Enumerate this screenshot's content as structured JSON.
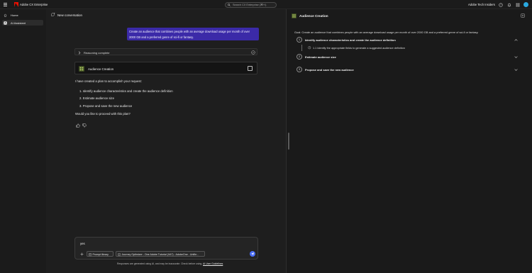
{
  "app": {
    "title": "Adobe CX Enterprise",
    "org_name": "Adobe Tech Insiders",
    "search_placeholder": "Search CX Enterprise (⌘+/)"
  },
  "sidebar": {
    "items": [
      {
        "label": "Home",
        "icon": "home-icon"
      },
      {
        "label": "AI Assistant",
        "icon": "ai-assistant-icon",
        "active": true
      }
    ]
  },
  "conversation": {
    "title": "New conversation",
    "user_message_line1": "Create an audience that combines people with an average download usage per month of over",
    "user_message_line2": "2000 GB and a preferred genre of sci-fi or fantasy.",
    "reasoning_label": "Reasoning complete",
    "card_title": "Audience Creation",
    "response_intro": "I have created a plan to accomplish your request:",
    "plan_items": [
      "1. Identify audience characteristics and create the audience definition",
      "2. Estimate audience size",
      "3. Propose and save the new audience"
    ],
    "response_question": "Would you like to proceed with this plan?",
    "composer_value": "yes",
    "prompt_library_label": "Prompt library",
    "context_chip_label": "Journey Optimizer - One Adobe Tutorial (VA7) - AdobeOne - Unifie...",
    "disclaimer_text": "Responses are generated using AI, and may be inaccurate. Check before using.",
    "disclaimer_link": "AI User Guidelines"
  },
  "panel": {
    "title": "Audience Creation",
    "goal": "Goal: Create an audience that combines people with an average download usage per month of over 2000 GB and a preferred genre of sci-fi or fantasy.",
    "steps": [
      {
        "number": "1",
        "label": "Identify audience characteristics and create the audience definition",
        "expanded": true
      },
      {
        "number": "2",
        "label": "Estimate audience size",
        "expanded": false
      },
      {
        "number": "3",
        "label": "Propose and save the new audience",
        "expanded": false
      }
    ],
    "substep": "1.1 Identify the appropriate fields to generate a suggested audience definition"
  },
  "colors": {
    "accent": "#3b2aa8",
    "brand": "#eb1000",
    "send": "#4b6ef5",
    "avatar": "#2aa9e0"
  }
}
